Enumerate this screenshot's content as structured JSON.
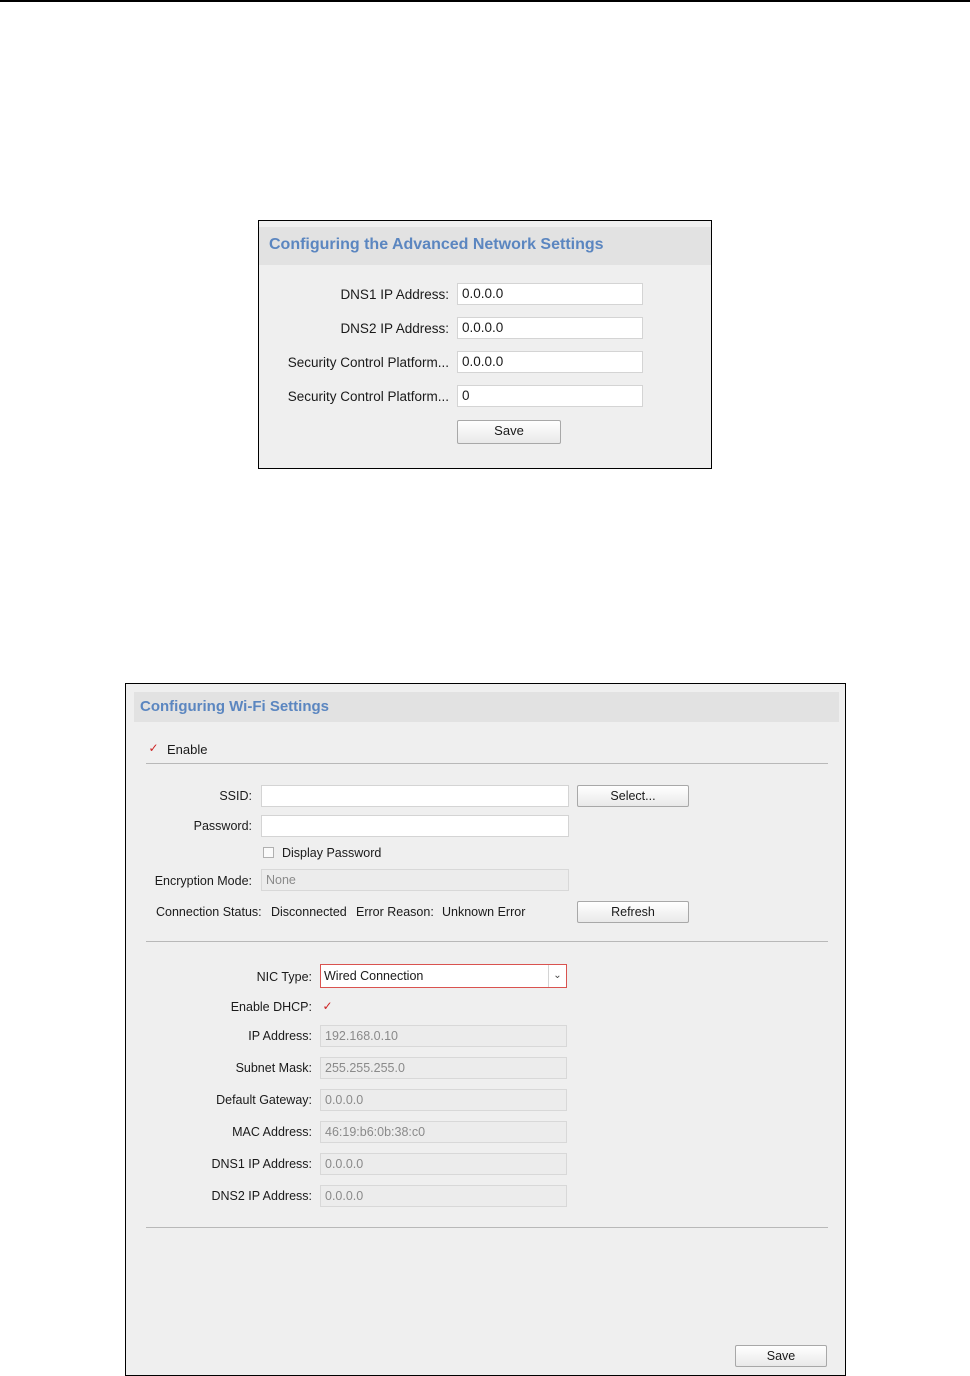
{
  "advanced": {
    "title": "Configuring the Advanced Network Settings",
    "rows": [
      {
        "label": "DNS1 IP Address:",
        "value": "0.0.0.0"
      },
      {
        "label": "DNS2 IP Address:",
        "value": "0.0.0.0"
      },
      {
        "label": "Security Control Platform...",
        "value": "0.0.0.0"
      },
      {
        "label": "Security Control Platform...",
        "value": "0"
      }
    ],
    "save_label": "Save"
  },
  "wifi": {
    "title": "Configuring Wi-Fi Settings",
    "enable_label": "Enable",
    "enable_checked": true,
    "ssid_label": "SSID:",
    "ssid_value": "",
    "select_label": "Select...",
    "password_label": "Password:",
    "password_value": "",
    "display_password_label": "Display Password",
    "display_password_checked": false,
    "encryption_label": "Encryption Mode:",
    "encryption_value": "None",
    "connection_status_label": "Connection Status:",
    "connection_status_value": "Disconnected",
    "error_reason_label": "Error Reason:",
    "error_reason_value": "Unknown Error",
    "refresh_label": "Refresh",
    "nic_type_label": "NIC Type:",
    "nic_type_value": "Wired Connection",
    "enable_dhcp_label": "Enable DHCP:",
    "enable_dhcp_checked": true,
    "ip_label": "IP Address:",
    "ip_value": "192.168.0.10",
    "subnet_label": "Subnet Mask:",
    "subnet_value": "255.255.255.0",
    "gateway_label": "Default Gateway:",
    "gateway_value": "0.0.0.0",
    "mac_label": "MAC Address:",
    "mac_value": "46:19:b6:0b:38:c0",
    "dns1_label": "DNS1 IP Address:",
    "dns1_value": "0.0.0.0",
    "dns2_label": "DNS2 IP Address:",
    "dns2_value": "0.0.0.0",
    "save_label": "Save"
  },
  "icons": {
    "check": "checkmark-icon",
    "dropdown": "chevron-down-icon"
  },
  "colors": {
    "header_text": "#5b86c0",
    "check": "#cc2222",
    "select_border": "#d9534f"
  }
}
